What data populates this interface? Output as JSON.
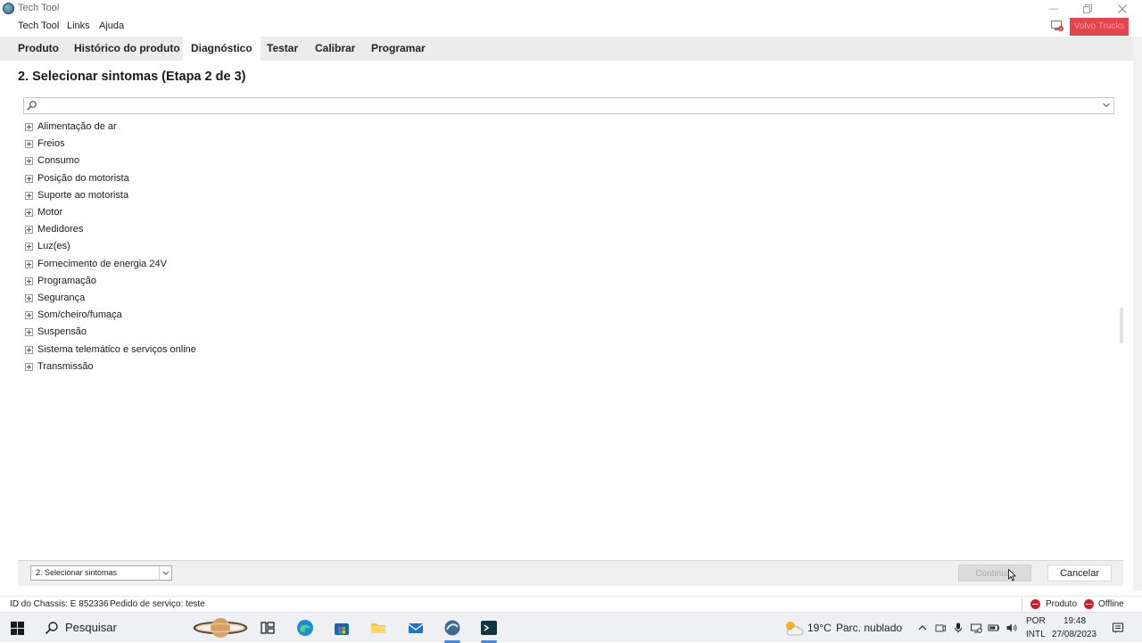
{
  "window": {
    "title": "Tech Tool",
    "brand_button": "Volvo Trucks"
  },
  "menu": {
    "items": [
      "Tech Tool",
      "Links",
      "Ajuda"
    ]
  },
  "tabs": [
    {
      "label": "Produto"
    },
    {
      "label": "Histórico do produto"
    },
    {
      "label": "Diagnóstico",
      "active": true
    },
    {
      "label": "Testar"
    },
    {
      "label": "Calibrar"
    },
    {
      "label": "Programar"
    }
  ],
  "page": {
    "title": "2. Selecionar sintomas (Etapa 2 de 3)"
  },
  "search": {
    "value": ""
  },
  "symptoms": [
    "Alimentação de ar",
    "Freios",
    "Consumo",
    "Posição do motorista",
    "Suporte ao motorista",
    "Motor",
    "Medidores",
    "Luz(es)",
    "Fornecimento de energia 24V",
    "Programação",
    "Segurança",
    "Som/cheiro/fumaça",
    "Suspensão",
    "Sistema telemático e serviços online",
    "Transmissão"
  ],
  "footer": {
    "step_select": "2. Selecionar sintomas",
    "continue": "Continuar",
    "cancel": "Cancelar"
  },
  "status": {
    "chassis": "ID do Chassis: E 852336",
    "order": "Pedido de serviço: teste",
    "product": "Produto",
    "offline": "Offline",
    "status_color": "#c8202b"
  },
  "taskbar": {
    "search_placeholder": "Pesquisar",
    "weather_temp": "19°C",
    "weather_desc": "Parc. nublado",
    "lang_1": "POR",
    "lang_2": "INTL",
    "time": "19:48",
    "date": "27/08/2023"
  }
}
